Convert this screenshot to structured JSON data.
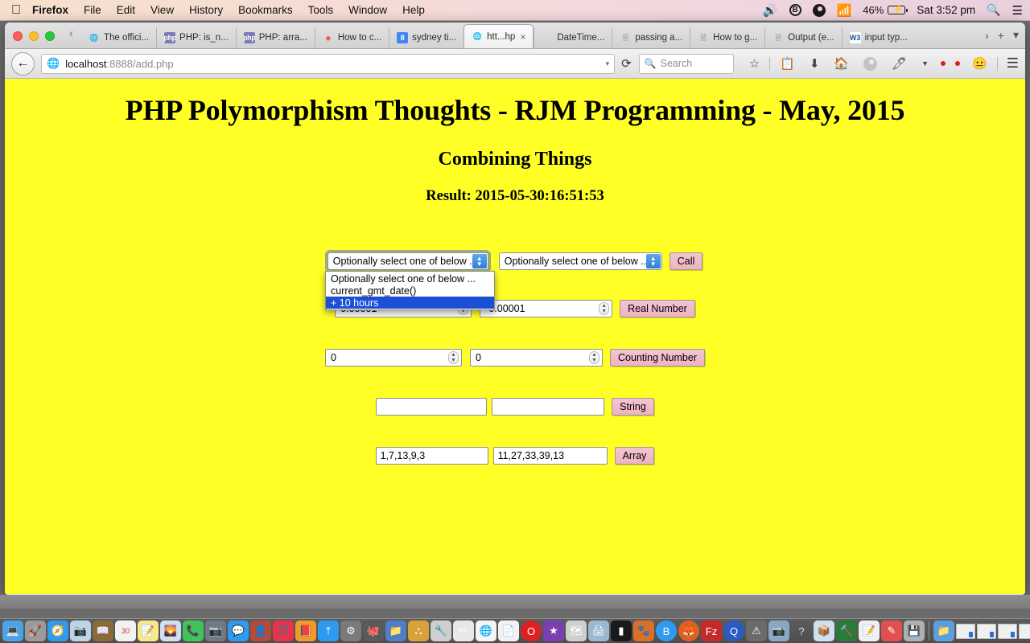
{
  "menubar": {
    "apple": "apple-logo",
    "items": [
      "Firefox",
      "File",
      "Edit",
      "View",
      "History",
      "Bookmarks",
      "Tools",
      "Window",
      "Help"
    ],
    "status": {
      "battery_percent": "46%",
      "clock": "Sat 3:52 pm",
      "icons": [
        "volume-icon",
        "bluetooth-icon",
        "dropbox-icon",
        "wifi-icon",
        "battery-charging-icon",
        "spotlight-search-icon",
        "notification-center-icon"
      ]
    }
  },
  "browser": {
    "tabs": [
      {
        "label": "The offici...",
        "favicon": "globe-icon",
        "active": false
      },
      {
        "label": "PHP: is_n...",
        "favicon": "php-icon",
        "active": false
      },
      {
        "label": "PHP: arra...",
        "favicon": "php-icon",
        "active": false
      },
      {
        "label": "How to c...",
        "favicon": "stackoverflow-icon",
        "active": false
      },
      {
        "label": "sydney ti...",
        "favicon": "google-icon",
        "active": false
      },
      {
        "label": "htt...hp",
        "favicon": "globe-icon",
        "active": true
      },
      {
        "label": "DateTime...",
        "favicon": "microsoft-icon",
        "active": false
      },
      {
        "label": "passing a...",
        "favicon": "java-doc-icon",
        "active": false
      },
      {
        "label": "How to g...",
        "favicon": "java-doc-icon",
        "active": false
      },
      {
        "label": "Output (e...",
        "favicon": "java-doc-icon",
        "active": false
      },
      {
        "label": "input typ...",
        "favicon": "w3schools-icon",
        "active": false
      }
    ],
    "tab_close_label": "×",
    "tabstrip_right": {
      "overflow": "›",
      "new_tab": "+",
      "list_all": "▾"
    },
    "scroll_left": "‹",
    "nav": {
      "back_label": "←",
      "url_host": "localhost",
      "url_rest": ":8888/add.php",
      "url_dropdown": "▾",
      "reload_label": "⟳",
      "search_placeholder": "Search",
      "icons": [
        "star-icon",
        "reader-icon",
        "download-icon",
        "home-icon",
        "sync-icon",
        "pocket-icon",
        "dropdown-icon",
        "smiley-icon",
        "menu-hamburger-icon"
      ]
    }
  },
  "page": {
    "title": "PHP Polymorphism Thoughts - RJM Programming - May, 2015",
    "subtitle": "Combining Things",
    "result": "Result: 2015-05-30:16:51:53",
    "select_placeholder": "Optionally select one of below ...",
    "dropdown_options": [
      {
        "label": "Optionally select one of below ...",
        "selected": false
      },
      {
        "label": "current_gmt_date()",
        "selected": false
      },
      {
        "label": "+ 10 hours",
        "selected": true
      }
    ],
    "rows": [
      {
        "name": "call",
        "left": "",
        "right": "",
        "button": "Call"
      },
      {
        "name": "real-number",
        "left": "0.00001",
        "right": "-0.00001",
        "button": "Real Number"
      },
      {
        "name": "counting-number",
        "left": "0",
        "right": "0",
        "button": "Counting Number"
      },
      {
        "name": "string",
        "left": "",
        "right": "",
        "button": "String"
      },
      {
        "name": "array",
        "left": "1,7,13,9,3",
        "right": "11,27,33,39,13",
        "button": "Array"
      }
    ],
    "colors": {
      "background": "#ffff26",
      "button": "#f2bccb",
      "highlight": "#1a4fd6"
    }
  }
}
